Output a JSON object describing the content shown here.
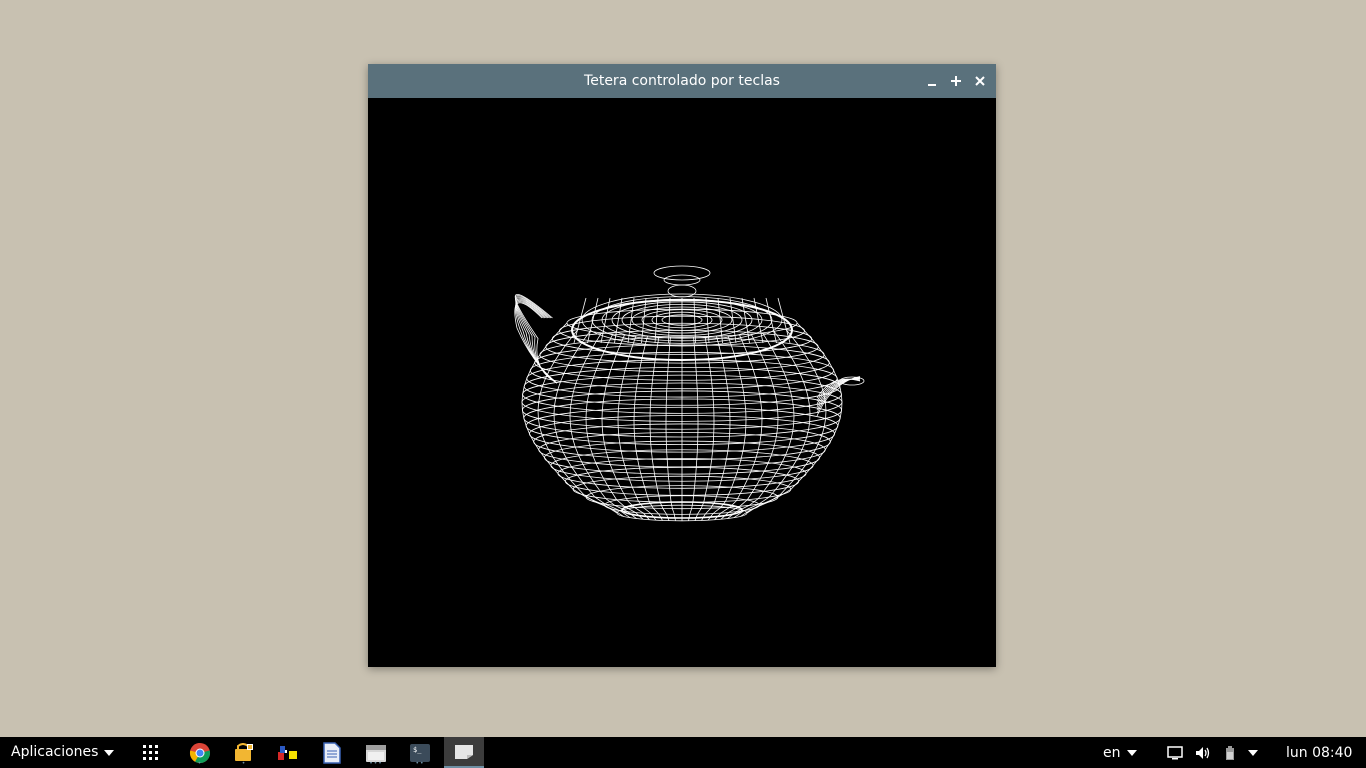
{
  "window": {
    "title": "Tetera controlado por teclas",
    "minimize_label": "–",
    "maximize_label": "+",
    "close_label": "×"
  },
  "taskbar": {
    "applications_label": "Aplicaciones",
    "launchers": [
      {
        "name": "app-grid-icon"
      },
      {
        "name": "chrome-icon"
      },
      {
        "name": "software-store-icon"
      },
      {
        "name": "color-tool-icon"
      },
      {
        "name": "document-editor-icon"
      },
      {
        "name": "file-manager-icon"
      },
      {
        "name": "terminal-icon"
      },
      {
        "name": "teapot-app-icon"
      }
    ],
    "keyboard_layout": "en",
    "clock": "lun 08:40"
  },
  "colors": {
    "desktop": "#c8c1b1",
    "titlebar": "#5a717c",
    "taskbar": "#000000",
    "wireframe": "#ffffff"
  }
}
